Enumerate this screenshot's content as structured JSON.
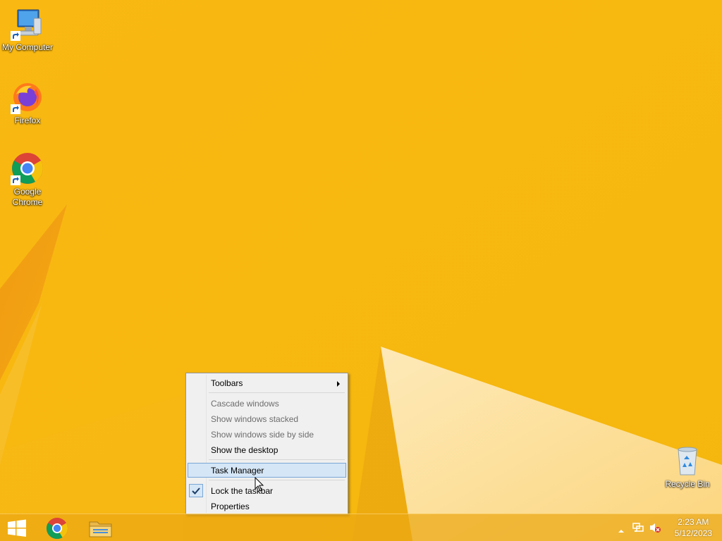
{
  "desktop": {
    "icons": [
      {
        "label": "My Computer",
        "icon": "computer-icon"
      },
      {
        "label": "Firefox",
        "icon": "firefox-icon"
      },
      {
        "label": "Google Chrome",
        "icon": "chrome-icon"
      },
      {
        "label": "Recycle Bin",
        "icon": "recycle-bin-icon"
      }
    ]
  },
  "context_menu": {
    "items": [
      {
        "label": "Toolbars",
        "enabled": true,
        "submenu": true
      },
      {
        "label": "Cascade windows",
        "enabled": false
      },
      {
        "label": "Show windows stacked",
        "enabled": false
      },
      {
        "label": "Show windows side by side",
        "enabled": false
      },
      {
        "label": "Show the desktop",
        "enabled": true
      },
      {
        "label": "Task Manager",
        "enabled": true,
        "highlighted": true
      },
      {
        "label": "Lock the taskbar",
        "enabled": true,
        "checked": true
      },
      {
        "label": "Properties",
        "enabled": true
      }
    ]
  },
  "taskbar": {
    "pinned": [
      {
        "icon": "windows-start-icon"
      },
      {
        "icon": "chrome-icon"
      },
      {
        "icon": "file-explorer-icon"
      }
    ],
    "tray_icons": [
      "show-hidden-icons-chevron-icon",
      "network-icon",
      "volume-muted-icon"
    ],
    "clock": {
      "time": "2:23 AM",
      "date": "5/12/2023"
    }
  },
  "colors": {
    "wallpaper": "#f8b70e",
    "menu_background": "#f0f0f0",
    "menu_highlight": "#d5e6f6",
    "menu_highlight_border": "#7aa7d6"
  }
}
